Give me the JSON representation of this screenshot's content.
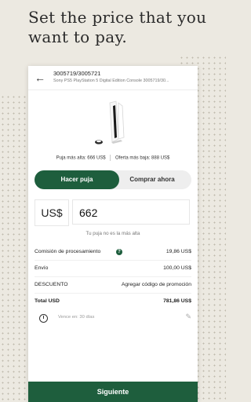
{
  "headline": "Set the price that you want to pay.",
  "header": {
    "title": "3005719/3005721",
    "subtitle": "Sony PS5 PlayStation 5 Digital Edition Console 3005719/30..."
  },
  "product": {
    "image_icon": "ps5-console-image"
  },
  "prices": {
    "highest_bid": "Puja más alta: 666 US$",
    "lowest_offer": "Oferta más baja: 888 US$"
  },
  "toggle": {
    "bid": "Hacer puja",
    "buy": "Comprar ahora"
  },
  "bid": {
    "currency": "US$",
    "amount": "662",
    "hint": "Tu puja no es la más alta"
  },
  "fees": {
    "processing_label": "Comisión de procesamiento",
    "processing_value": "19,86 US$",
    "shipping_label": "Envío",
    "shipping_value": "100,00 US$",
    "discount_label": "DESCUENTO",
    "discount_value": "Agregar código de promoción",
    "total_label": "Total USD",
    "total_value": "781,86 US$"
  },
  "expiry": {
    "text": "Vence en: 30 días"
  },
  "next_button": "Siguiente",
  "colors": {
    "accent": "#1e5e3d",
    "background": "#ece9e1"
  }
}
